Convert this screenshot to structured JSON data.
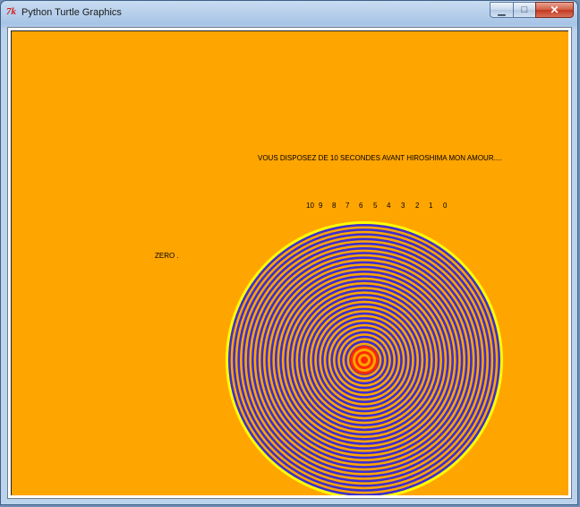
{
  "window": {
    "title": "Python Turtle Graphics",
    "app_icon_text": "7k",
    "controls": {
      "minimize_symbol": "▁",
      "maximize_symbol": "□",
      "close_symbol": "✕"
    }
  },
  "canvas": {
    "background": "#ffa500",
    "headline": "VOUS DISPOSEZ DE 10 SECONDES AVANT HIROSHIMA MON AMOUR....",
    "countdown": [
      "10",
      "9",
      "8",
      "7",
      "6",
      "5",
      "4",
      "3",
      "2",
      "1",
      "0"
    ],
    "zero_label": "ZERO .",
    "spiral_colors": {
      "outer_ring": "#ffff00",
      "band_a": "#ffa500",
      "band_b": "#3c2ed0",
      "center": "#ff2a00"
    }
  }
}
